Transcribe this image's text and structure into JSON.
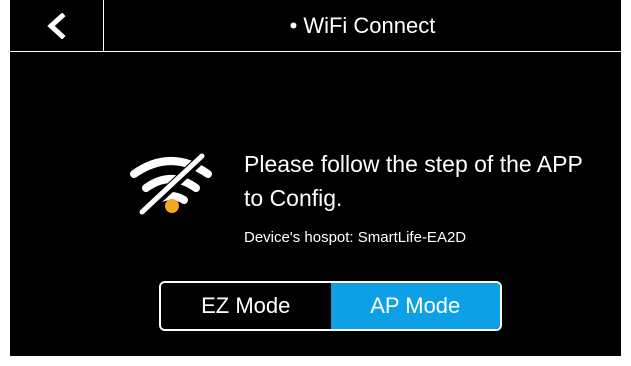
{
  "header": {
    "bullet": "•",
    "title": "WiFi Connect"
  },
  "icons": {
    "back": "chevron-left-icon",
    "wifi_status": "wifi-off-icon"
  },
  "message": {
    "line1": "Please follow the step of the APP",
    "line2": "to Config."
  },
  "hotspot": {
    "text": "Device's hospot: SmartLife-EA2D"
  },
  "mode_switch": {
    "options": [
      "EZ Mode",
      "AP Mode"
    ],
    "selected": "AP Mode"
  },
  "colors": {
    "background": "#000000",
    "foreground": "#ffffff",
    "accent": "#0ea0e6",
    "wifi_dot": "#f5a623"
  }
}
